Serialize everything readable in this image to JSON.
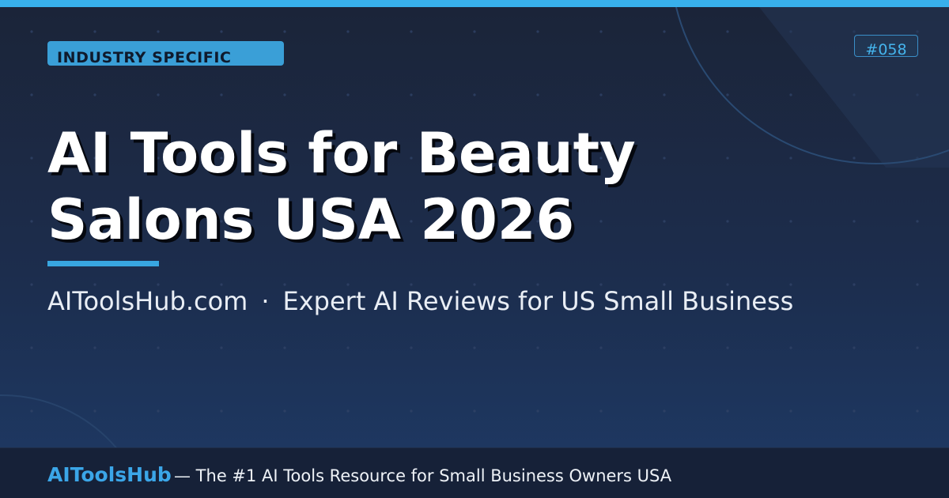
{
  "badge": {
    "label": "INDUSTRY SPECIFIC"
  },
  "id_tag": {
    "label": "#058"
  },
  "title": {
    "line1": "AI Tools for Beauty",
    "line2": "Salons USA 2026"
  },
  "subtitle": {
    "site": "AIToolsHub.com",
    "separator": "·",
    "tagline": "Expert AI Reviews for US Small Business"
  },
  "footer": {
    "brand": "AIToolsHub",
    "tagline": "— The #1 AI Tools Resource for Small Business Owners USA"
  },
  "colors": {
    "accent": "#38b0ec",
    "background_top": "#1b2438",
    "background_bottom": "#1e3a66",
    "footer_bg": "#162138",
    "title": "#ffffff"
  }
}
